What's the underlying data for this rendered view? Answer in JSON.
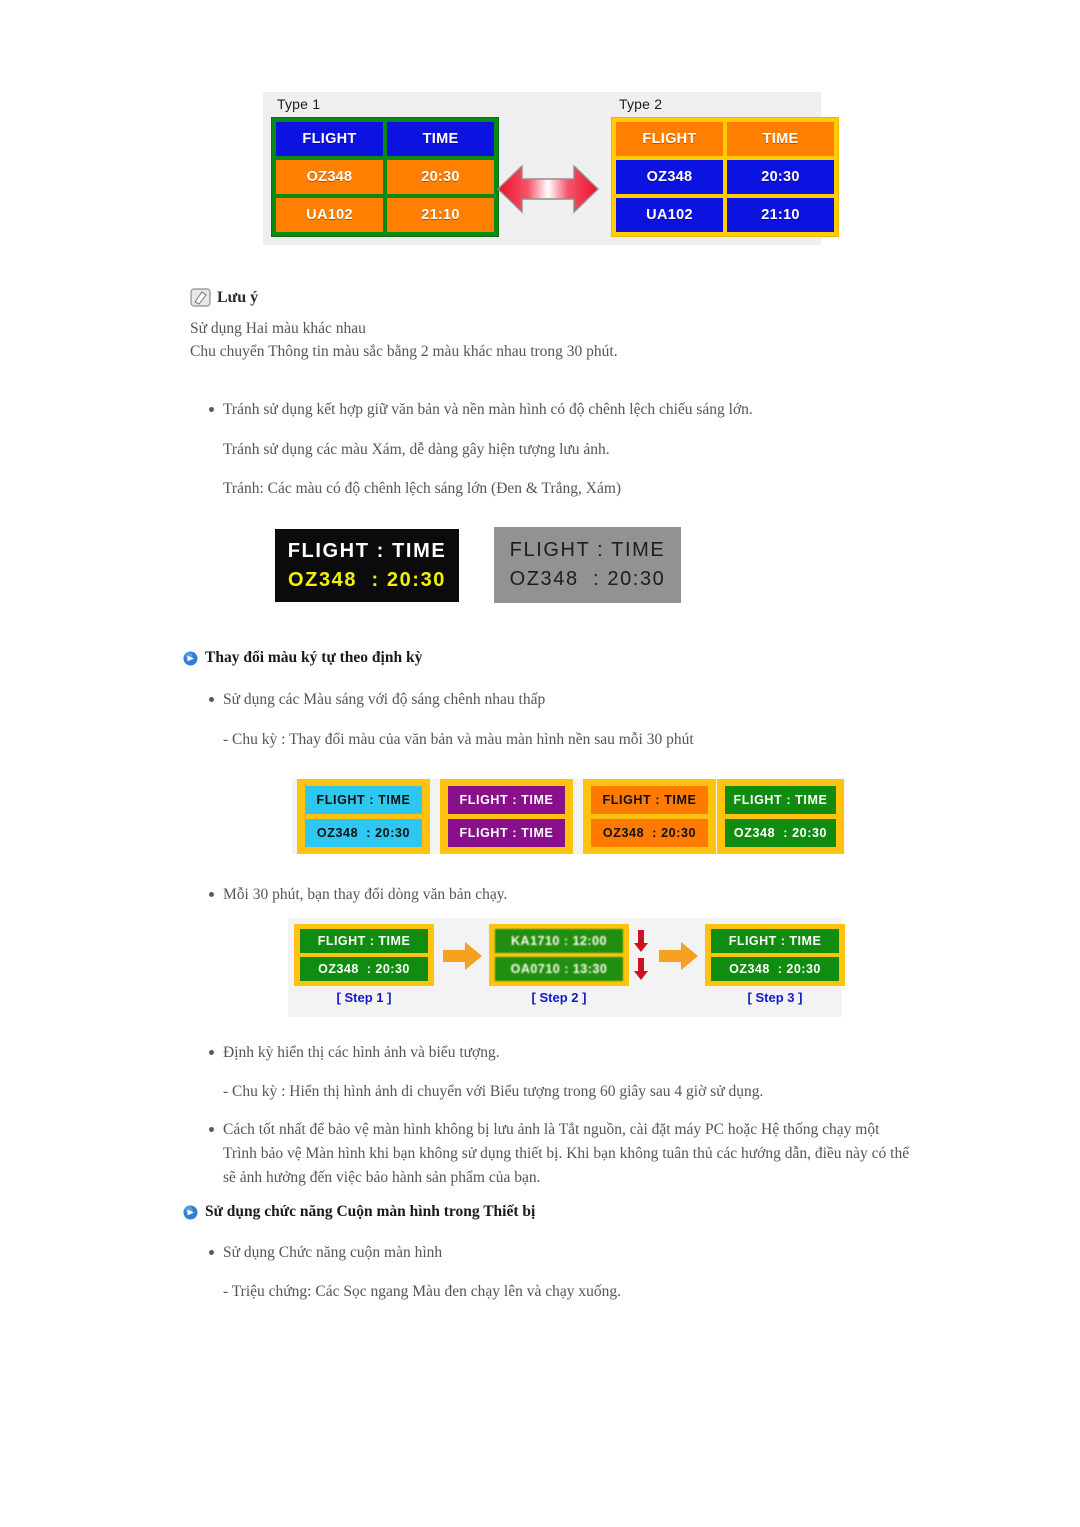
{
  "figure_type_compare": {
    "type1_label": "Type 1",
    "type2_label": "Type 2",
    "arrow_icon": "double-headed-horizontal-arrow",
    "type1": {
      "frame_color": "#0a8a15",
      "rows": [
        {
          "left": "FLIGHT",
          "right": "TIME",
          "cell_color": "#0c12e0"
        },
        {
          "left": "OZ348",
          "right": "20:30",
          "cell_color": "#ff8000"
        },
        {
          "left": "UA102",
          "right": "21:10",
          "cell_color": "#ff8000"
        }
      ]
    },
    "type2": {
      "frame_color": "#ffcc00",
      "rows": [
        {
          "left": "FLIGHT",
          "right": "TIME",
          "cell_color": "#ff8000"
        },
        {
          "left": "OZ348",
          "right": "20:30",
          "cell_color": "#0c12e0"
        },
        {
          "left": "UA102",
          "right": "21:10",
          "cell_color": "#0c12e0"
        }
      ]
    }
  },
  "note": {
    "icon": "note-pencil-icon",
    "title": "Lưu ý",
    "line1": "Sử dụng Hai màu khác nhau",
    "line2": "Chu chuyển Thông tin màu sắc bằng 2 màu khác nhau trong 30 phút."
  },
  "avoid_list": {
    "bullet1": "Tránh sử dụng kết hợp giữ văn bản và nền màn hình có độ chênh lệch chiếu sáng lớn.",
    "line2": "Tránh sử dụng các màu Xám, dễ dàng gây hiện tượng lưu ảnh.",
    "line3": "Tránh: Các màu có độ chênh lệch sáng lớn (Đen & Trắng, Xám)"
  },
  "figure_contrast": {
    "black_panel": {
      "bg": "#0b0b0b",
      "line1": "FLIGHT : TIME",
      "line1_color": "#ffffff",
      "line2": "OZ348  : 20:30",
      "line2_color": "#f2f200"
    },
    "gray_panel": {
      "bg": "#929292",
      "line1": "FLIGHT : TIME",
      "line2": "OZ348  : 20:30",
      "text_color": "#1d1d1d"
    }
  },
  "section_color_cycle": {
    "icon": "blue-arrow-bullet-icon",
    "title": "Thay đổi màu ký tự theo định kỳ",
    "bullet1": "Sử dụng các Màu sáng với độ sáng chênh nhau thấp",
    "sub1": "- Chu kỳ : Thay đổi màu của văn bản và màu màn hình nền sau mỗi 30 phút",
    "bullet2": "Mỗi 30 phút, bạn thay đổi dòng văn bản chạy.",
    "bullet3": "Định kỳ hiển thị các hình ảnh và biểu tượng.",
    "sub2": "- Chu kỳ : Hiển thị hình ảnh di chuyển với Biểu tượng trong 60 giây sau 4 giờ sử dụng.",
    "bullet4": "Cách tốt nhất để bảo vệ màn hình không bị lưu ảnh là Tắt nguồn, cài đặt máy PC hoặc Hệ thống chạy một Trình bảo vệ Màn hình khi bạn không sử dụng thiết bị. Khi bạn không tuân thủ các hướng dẫn, điều này có thể sẽ ảnh hưởng đến việc bảo hành sản phẩm của bạn."
  },
  "figure_color_samples": {
    "frame_color": "#ffc20e",
    "samples": [
      {
        "bg": "#2ec7f0",
        "text_color": "#101010",
        "line1": "FLIGHT : TIME",
        "line2": "OZ348  : 20:30"
      },
      {
        "bg": "#8a0f8a",
        "text_color": "#ffffff",
        "line1": "FLIGHT : TIME",
        "line2": "FLIGHT : TIME"
      },
      {
        "bg": "#ff7a00",
        "text_color": "#101010",
        "line1": "FLIGHT : TIME",
        "line2": "OZ348  : 20:30"
      },
      {
        "bg": "#108c10",
        "text_color": "#ffffff",
        "line1": "FLIGHT : TIME",
        "line2": "OZ348  : 20:30"
      }
    ]
  },
  "figure_steps": {
    "arrow_icon": "orange-right-arrow-icon",
    "scroll_icon": "red-down-arrow-icon",
    "steps": [
      {
        "caption": "[ Step 1 ]",
        "line1": "FLIGHT : TIME",
        "line2": "OZ348  : 20:30",
        "blurred": false
      },
      {
        "caption": "[ Step 2 ]",
        "line1": "KA1710 : 12:00",
        "line2": "OA0710 : 13:30",
        "blurred": true
      },
      {
        "caption": "[ Step 3 ]",
        "line1": "FLIGHT : TIME",
        "line2": "OZ348  : 20:30",
        "blurred": false
      }
    ]
  },
  "section_screen_scroll": {
    "icon": "blue-arrow-bullet-icon",
    "title": "Sử dụng chức năng Cuộn màn hình trong Thiết bị",
    "bullet1": "Sử dụng Chức năng cuộn màn hình",
    "sub1": "- Triệu chứng: Các Sọc ngang Màu đen chạy lên và chạy xuống."
  }
}
